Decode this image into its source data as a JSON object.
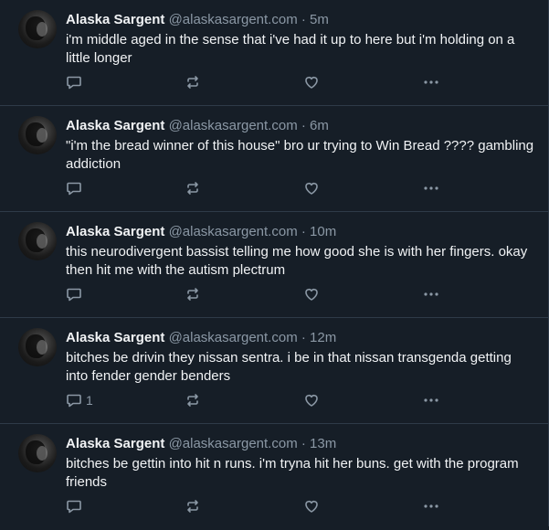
{
  "posts": [
    {
      "author_name": "Alaska Sargent",
      "author_handle": "@alaskasargent.com",
      "separator": "·",
      "time": "5m",
      "text": "i'm middle aged in the sense that i've had it up to here but i'm holding on a little longer",
      "reply_count": ""
    },
    {
      "author_name": "Alaska Sargent",
      "author_handle": "@alaskasargent.com",
      "separator": "·",
      "time": "6m",
      "text": "\"i'm the bread winner of this house\" bro ur trying to Win Bread ???? gambling addiction",
      "reply_count": ""
    },
    {
      "author_name": "Alaska Sargent",
      "author_handle": "@alaskasargent.com",
      "separator": "·",
      "time": "10m",
      "text": "this neurodivergent bassist telling me how good she is with her fingers. okay then hit me with the autism plectrum",
      "reply_count": ""
    },
    {
      "author_name": "Alaska Sargent",
      "author_handle": "@alaskasargent.com",
      "separator": "·",
      "time": "12m",
      "text": "bitches be drivin they nissan sentra. i be in that nissan transgenda getting into fender gender benders",
      "reply_count": "1"
    },
    {
      "author_name": "Alaska Sargent",
      "author_handle": "@alaskasargent.com",
      "separator": "·",
      "time": "13m",
      "text": "bitches be gettin into hit n runs. i'm tryna hit her buns. get with the program friends",
      "reply_count": ""
    }
  ],
  "icons": {
    "reply": "reply-icon",
    "repost": "repost-icon",
    "like": "like-icon",
    "more": "more-icon"
  },
  "colors": {
    "background": "#161e27",
    "divider": "#2e3a48",
    "primary_text": "#f1f3f5",
    "secondary_text": "#8b98a5"
  }
}
